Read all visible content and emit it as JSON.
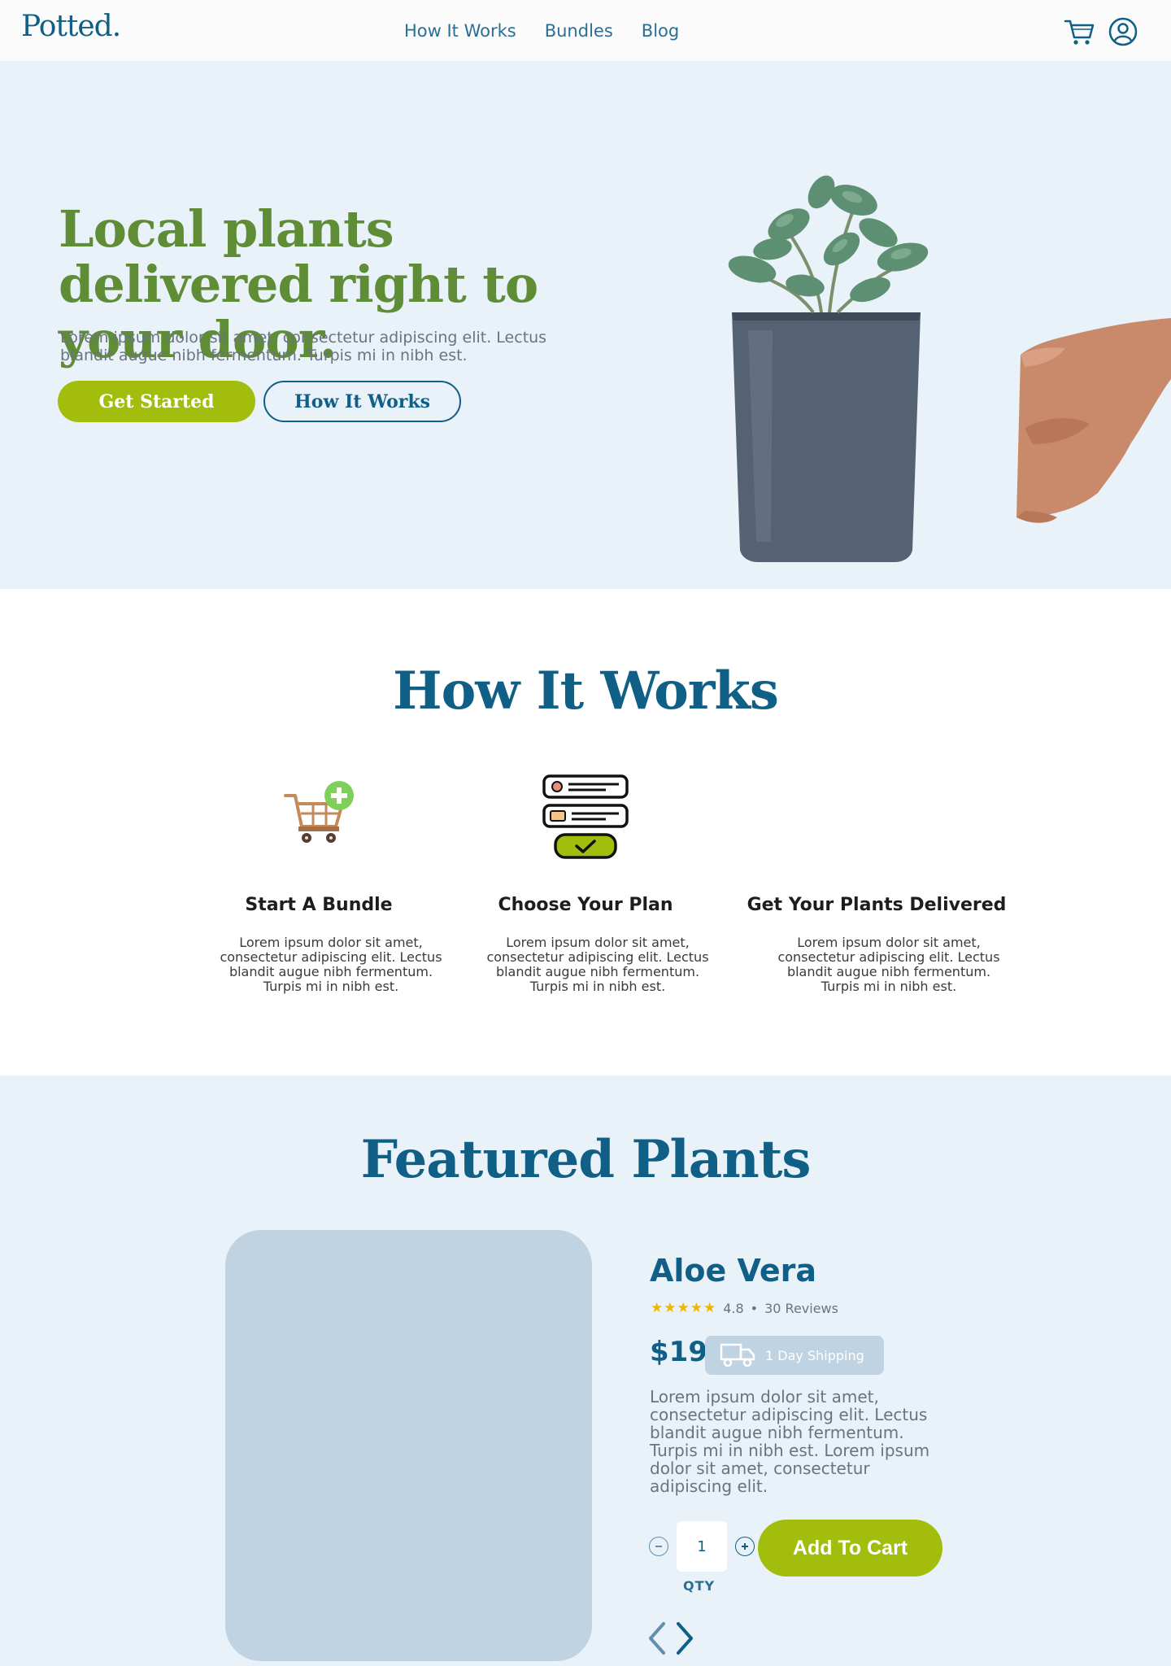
{
  "brand": {
    "logo": "Potted."
  },
  "nav": {
    "links": [
      "How It Works",
      "Bundles",
      "Blog"
    ],
    "icons": {
      "cart": "cart-icon",
      "account": "account-icon"
    }
  },
  "hero": {
    "title": "Local plants delivered right to your door.",
    "subtitle": "Lorem ipsum dolor sit amet, consectetur adipiscing elit. Lectus blandit augue nibh fermentum. Turpis mi in nibh est.",
    "primary_button": "Get Started",
    "secondary_button": "How It Works"
  },
  "how_it_works": {
    "title": "How It Works",
    "steps": [
      {
        "icon": "cart-plus-icon",
        "title": "Start A Bundle",
        "desc": "Lorem ipsum dolor sit amet, consectetur adipiscing elit. Lectus blandit augue nibh fermentum. Turpis mi in nibh est."
      },
      {
        "icon": "plan-list-icon",
        "title": "Choose Your Plan",
        "desc": "Lorem ipsum dolor sit amet, consectetur adipiscing elit. Lectus blandit augue nibh fermentum. Turpis mi in nibh est."
      },
      {
        "icon": "",
        "title": "Get Your Plants Delivered",
        "desc": "Lorem ipsum dolor sit amet, consectetur adipiscing elit. Lectus blandit augue nibh fermentum. Turpis mi in nibh est."
      }
    ]
  },
  "featured": {
    "title": "Featured Plants",
    "product": {
      "name": "Aloe Vera",
      "stars": "★★★★★",
      "rating": "4.8",
      "separator": "•",
      "reviews": "30 Reviews",
      "price": "$19",
      "shipping": "1 Day Shipping",
      "description": "Lorem ipsum dolor sit amet, consectetur adipiscing elit. Lectus blandit augue nibh fermentum. Turpis mi in nibh est. Lorem ipsum dolor sit amet, consectetur adipiscing elit.",
      "qty": "1",
      "qty_label": "QTY",
      "add_to_cart": "Add To Cart"
    }
  },
  "colors": {
    "brand_blue": "#0f5f86",
    "hero_green": "#5f8d36",
    "accent_lime": "#a3bd0c",
    "section_bg": "#e9f1f9",
    "placeholder": "#bfd3e3"
  }
}
